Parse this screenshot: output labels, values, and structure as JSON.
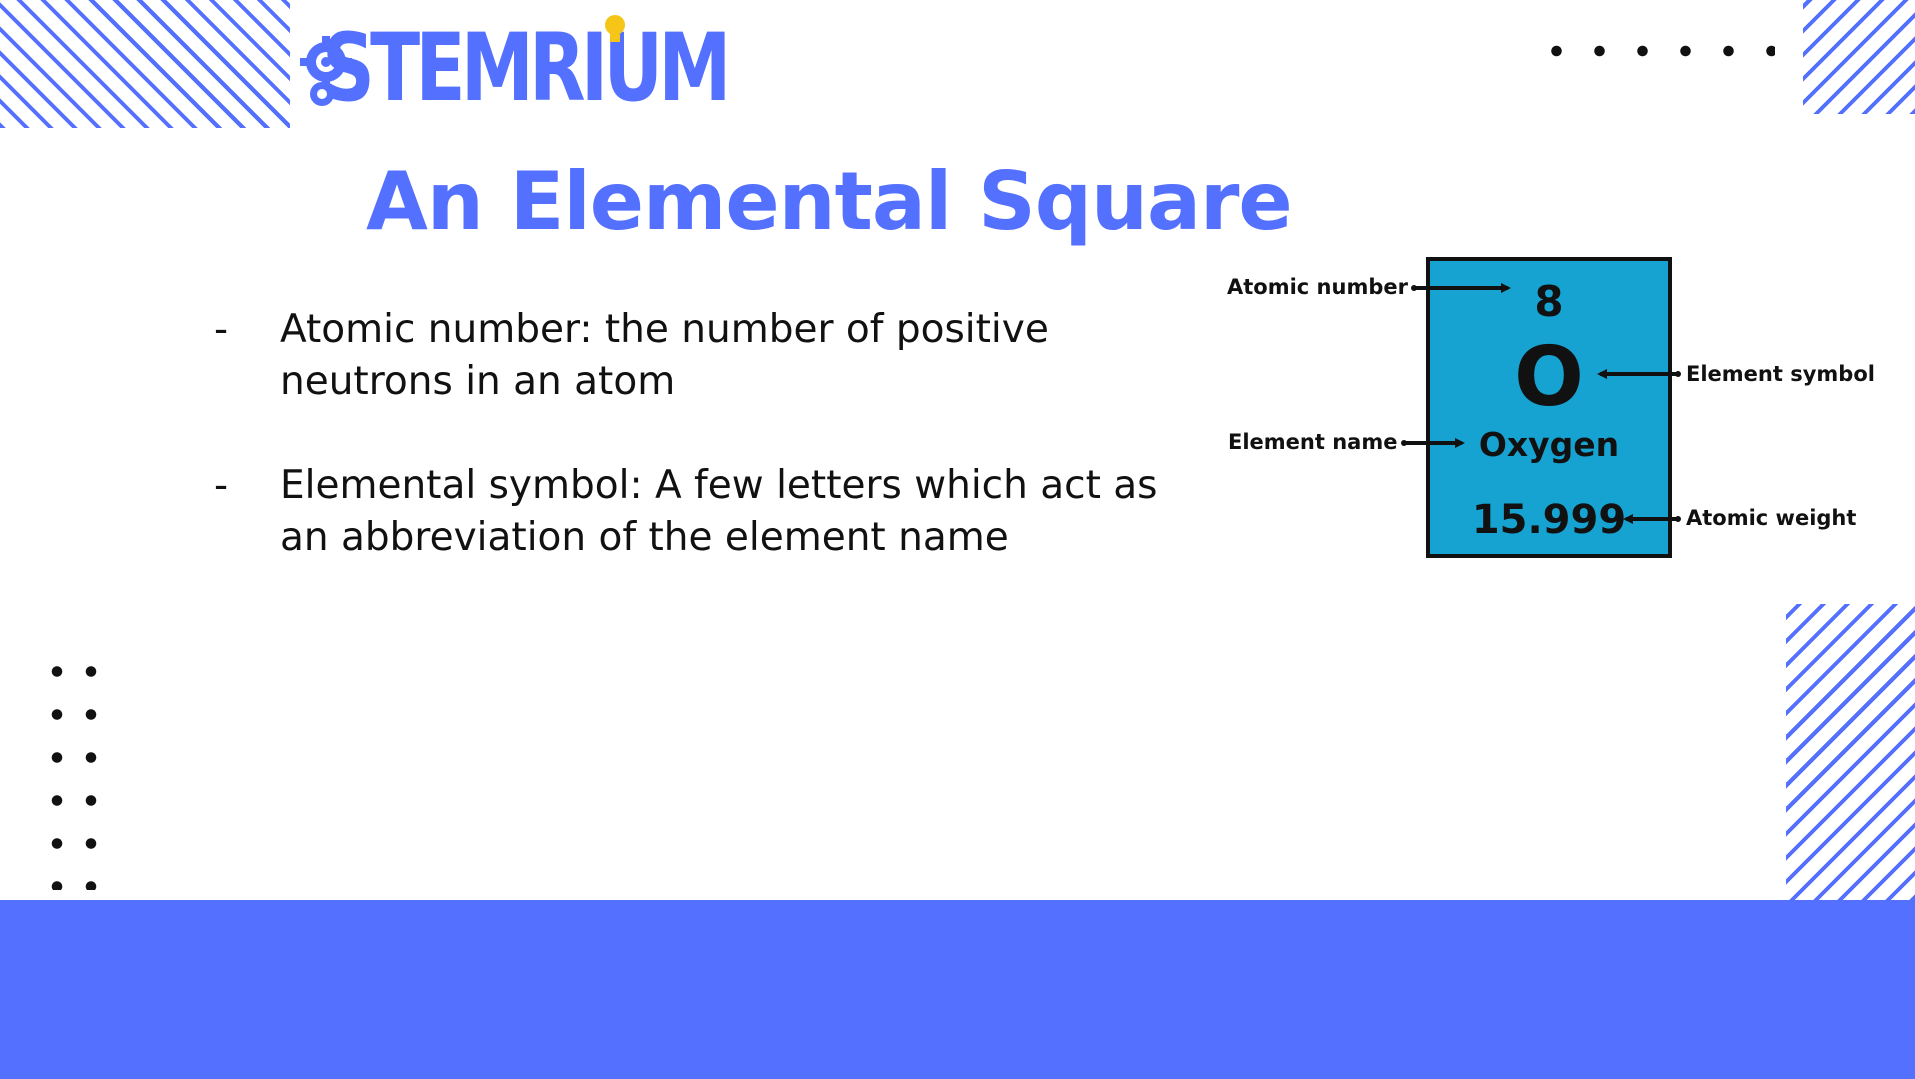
{
  "brand": {
    "logo_text": "STEMRIUM",
    "primary_color": "#5470ff",
    "accent_color": "#f5c518",
    "square_color": "#17a3d1"
  },
  "slide": {
    "title": "An Elemental Square",
    "bullets": [
      {
        "dash": "-",
        "text": "Atomic number: the number of positive neutrons in an atom"
      },
      {
        "dash": "-",
        "text": "Elemental symbol: A few letters which act as an abbreviation of the element name"
      }
    ]
  },
  "element_card": {
    "atomic_number": "8",
    "symbol": "O",
    "name": "Oxygen",
    "atomic_weight": "15.999",
    "labels": {
      "atomic_number": "Atomic number",
      "element_symbol": "Element symbol",
      "element_name": "Element name",
      "atomic_weight": "Atomic weight"
    }
  }
}
